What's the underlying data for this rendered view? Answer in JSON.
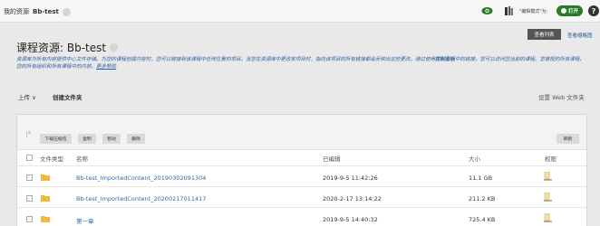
{
  "breadcrumb": {
    "root": "我的资源",
    "current": "Bb-test"
  },
  "topbar": {
    "edit_mode_label": "\"编辑模式\"为:",
    "toggle_label": "打开",
    "help": "?"
  },
  "header": {
    "view_list": "查看列表",
    "view_thumbnails": "查看缩略图",
    "title": "课程资源: Bb-test",
    "description_1": "资源库为所有内容提供中心文件存储。为您的课程创建内容时，您可以链接到该课程中任何位置的项目。当您在资源库中更改某项目时，指向该项目的所有链接都会反映出这些更改。通过使用",
    "description_bold": "控制面板",
    "description_2": "中的链接，您可以访问您当前的课程、您被授的所有课程、您的所有组织和所有课程中的内容。",
    "description_more": "更多帮助"
  },
  "actions": {
    "upload": "上传 ∨",
    "create_folder": "创建文件夹",
    "web_settings": "设置 Web 文件夹"
  },
  "toolbar": {
    "download": "下载压缩包",
    "copy": "复制",
    "move": "移动",
    "delete": "删除",
    "refresh": "刷新"
  },
  "columns": {
    "type": "文件类型",
    "name": "名称",
    "edited": "已编辑",
    "size": "大小",
    "permission": "权限"
  },
  "rows": [
    {
      "name": "Bb-test_ImportedContent_20190302091304",
      "edited": "2019-9-5 11:42:26",
      "size": "11.1 GB"
    },
    {
      "name": "Bb-test_ImportedContent_20200217011417",
      "edited": "2020-2-17 13:14:22",
      "size": "211.2 KB"
    },
    {
      "name": "第一章",
      "edited": "2019-9-5 14:40:32",
      "size": "725.4 KB"
    }
  ],
  "colors": {
    "accent": "#2a7a2a",
    "link": "#2a6bb0",
    "folder": "#f3b73a"
  }
}
